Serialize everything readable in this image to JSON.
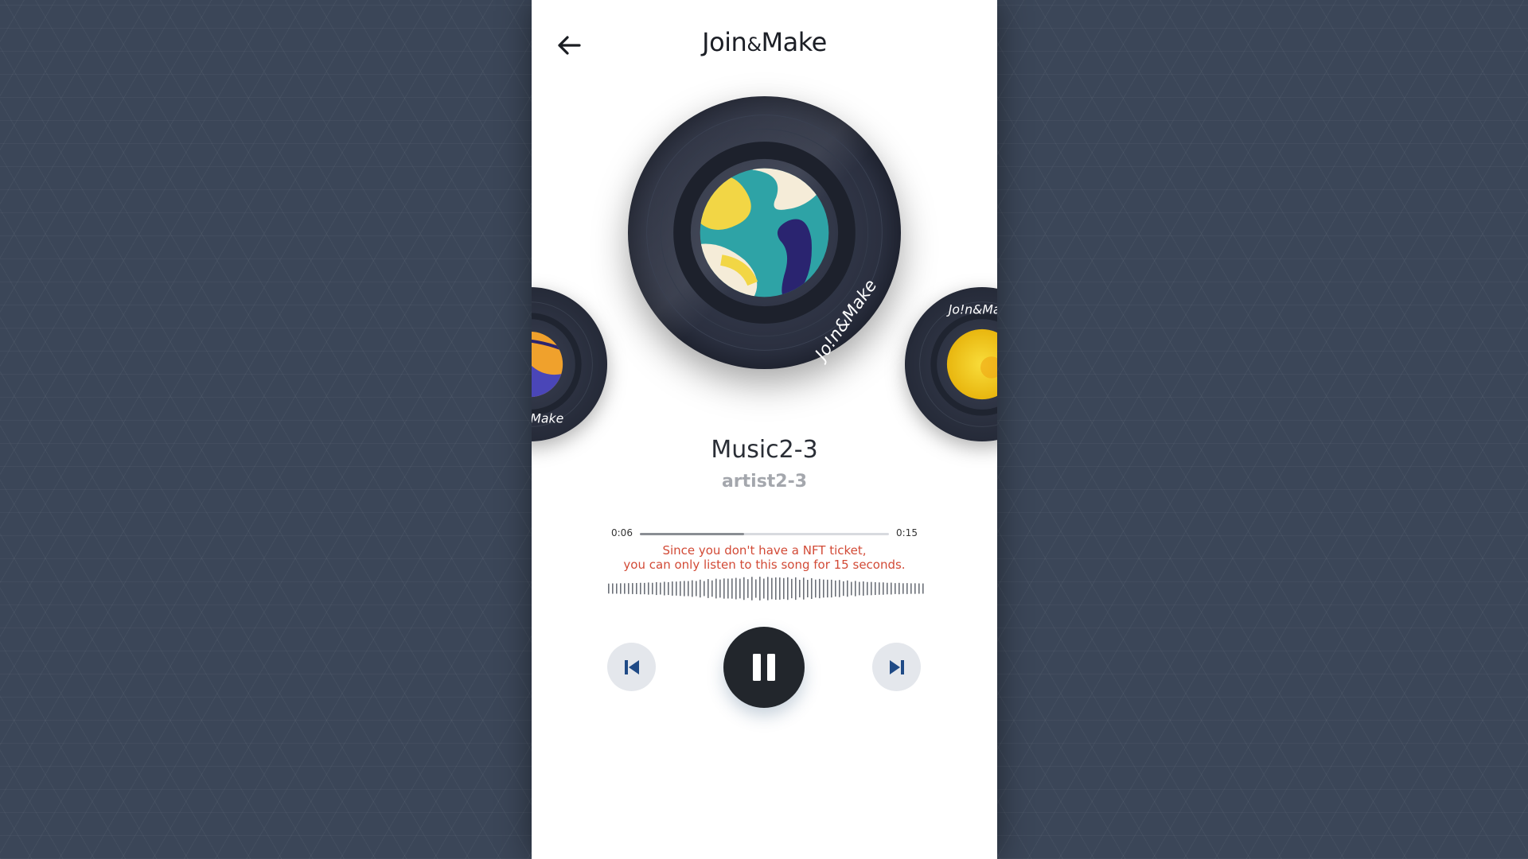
{
  "header": {
    "logo_left": "Join",
    "logo_amp": "&",
    "logo_right": "Make"
  },
  "records": {
    "main": {
      "label_text": "Jo!n&Make",
      "colors": [
        "#2ea3a6",
        "#f2d645",
        "#f5ecd8",
        "#2a2470"
      ]
    },
    "left": {
      "label_text": "Jo!n&Make",
      "colors": [
        "#f0a12c",
        "#4a46b8"
      ]
    },
    "right": {
      "label_text": "Jo!n&Make",
      "colors": [
        "#f5d21d",
        "#e8b60f"
      ]
    }
  },
  "track": {
    "title": "Music2-3",
    "artist": "artist2-3"
  },
  "player": {
    "current_time": "0:06",
    "total_time": "0:15",
    "progress": 0.42,
    "notice_line1": "Since you don't have a NFT ticket,",
    "notice_line2": "you can only listen to this song for 15 seconds."
  },
  "controls": {
    "prev_icon": "skip-previous-icon",
    "pause_icon": "pause-icon",
    "next_icon": "skip-next-icon"
  },
  "colors": {
    "accent_icon": "#1f4a86",
    "notice": "#d24a36",
    "record": "#2b3040"
  }
}
